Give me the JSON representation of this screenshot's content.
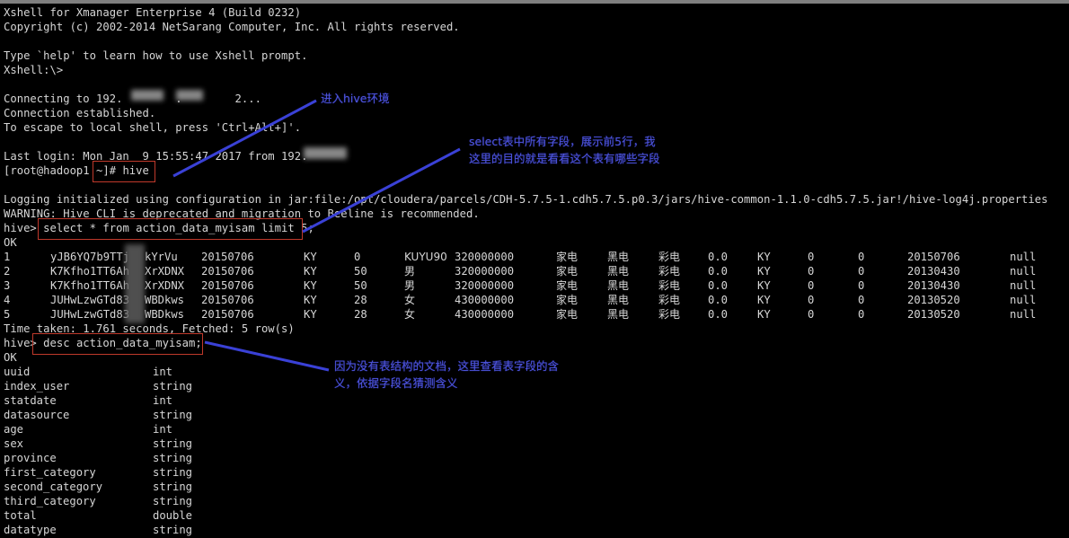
{
  "window": {
    "title_line": "Xshell for Xmanager Enterprise 4 (Build 0232)",
    "copyright_line": "Copyright (c) 2002-2014 NetSarang Computer, Inc. All rights reserved."
  },
  "terminal": {
    "help_line": "Type `help' to learn how to use Xshell prompt.",
    "prompt_local": "Xshell:\\>",
    "connecting": "Connecting to 192.        .        2...",
    "connection_established": "Connection established.",
    "escape_hint": "To escape to local shell, press 'Ctrl+Alt+]'.",
    "last_login": "Last login: Mon Jan  9 15:55:47 2017 from 192.",
    "shell_prompt": "[root@hadoop1 ~]# ",
    "hive_command": "hive",
    "logging_line": "Logging initialized using configuration in jar:file:/opt/cloudera/parcels/CDH-5.7.5-1.cdh5.7.5.p0.3/jars/hive-common-1.1.0-cdh5.7.5.jar!/hive-log4j.properties",
    "warning_line": "WARNING: Hive CLI is deprecated and migration to Beeline is recommended.",
    "hive_prompt": "hive> ",
    "select_command": "select * from action_data_myisam limit 5;",
    "ok_1": "OK",
    "time_taken": "Time taken: 1.761 seconds, Fetched: 5 row(s)",
    "desc_command": "desc action_data_myisam;",
    "ok_2": "OK"
  },
  "result_table": {
    "rows": [
      {
        "uuid": "1",
        "index_user_a": "yJB6YQ7b9TTj",
        "index_user_b": "kYrVu",
        "statdate": "20150706",
        "datasource": "KY",
        "age": "0",
        "sex": "KUYU90",
        "province": "320000000",
        "first_category": "家电",
        "second_category": "黑电",
        "third_category": "彩电",
        "total": "0.0",
        "datatype": "KY",
        "col_a": "0",
        "col_b": "0",
        "col_date": "20150706",
        "col_null": "null"
      },
      {
        "uuid": "2",
        "index_user_a": "K7Kfho1TT6Ah",
        "index_user_b": "XrXDNX",
        "statdate": "20150706",
        "datasource": "KY",
        "age": "50",
        "sex": "男",
        "province": "320000000",
        "first_category": "家电",
        "second_category": "黑电",
        "third_category": "彩电",
        "total": "0.0",
        "datatype": "KY",
        "col_a": "0",
        "col_b": "0",
        "col_date": "20130430",
        "col_null": "null"
      },
      {
        "uuid": "3",
        "index_user_a": "K7Kfho1TT6Ah",
        "index_user_b": "XrXDNX",
        "statdate": "20150706",
        "datasource": "KY",
        "age": "50",
        "sex": "男",
        "province": "320000000",
        "first_category": "家电",
        "second_category": "黑电",
        "third_category": "彩电",
        "total": "0.0",
        "datatype": "KY",
        "col_a": "0",
        "col_b": "0",
        "col_date": "20130430",
        "col_null": "null"
      },
      {
        "uuid": "4",
        "index_user_a": "JUHwLzwGTd83",
        "index_user_b": "WBDkws",
        "statdate": "20150706",
        "datasource": "KY",
        "age": "28",
        "sex": "女",
        "province": "430000000",
        "first_category": "家电",
        "second_category": "黑电",
        "third_category": "彩电",
        "total": "0.0",
        "datatype": "KY",
        "col_a": "0",
        "col_b": "0",
        "col_date": "20130520",
        "col_null": "null"
      },
      {
        "uuid": "5",
        "index_user_a": "JUHwLzwGTd83",
        "index_user_b": "WBDkws",
        "statdate": "20150706",
        "datasource": "KY",
        "age": "28",
        "sex": "女",
        "province": "430000000",
        "first_category": "家电",
        "second_category": "黑电",
        "third_category": "彩电",
        "total": "0.0",
        "datatype": "KY",
        "col_a": "0",
        "col_b": "0",
        "col_date": "20130520",
        "col_null": "null"
      }
    ]
  },
  "schema": {
    "columns": [
      {
        "name": "uuid",
        "type": "int"
      },
      {
        "name": "index_user",
        "type": "string"
      },
      {
        "name": "statdate",
        "type": "int"
      },
      {
        "name": "datasource",
        "type": "string"
      },
      {
        "name": "age",
        "type": "int"
      },
      {
        "name": "sex",
        "type": "string"
      },
      {
        "name": "province",
        "type": "string"
      },
      {
        "name": "first_category",
        "type": "string"
      },
      {
        "name": "second_category",
        "type": "string"
      },
      {
        "name": "third_category",
        "type": "string"
      },
      {
        "name": "total",
        "type": "double"
      },
      {
        "name": "datatype",
        "type": "string"
      }
    ]
  },
  "annotations": {
    "note_hive": "进入hive环境",
    "note_select_l1": "select表中所有字段，展示前5行，我",
    "note_select_l2": "这里的目的就是看看这个表有哪些字段",
    "note_desc_l1": "因为没有表结构的文档，这里查看表字段的含",
    "note_desc_l2": "义，依据字段名猜测含义"
  },
  "colors": {
    "background": "#000000",
    "terminal_text": "#d6d6d6",
    "annotation_blue": "#4d54d8",
    "highlight_box_red": "#c0392b",
    "title_strip_gray": "#7f7f7f"
  }
}
